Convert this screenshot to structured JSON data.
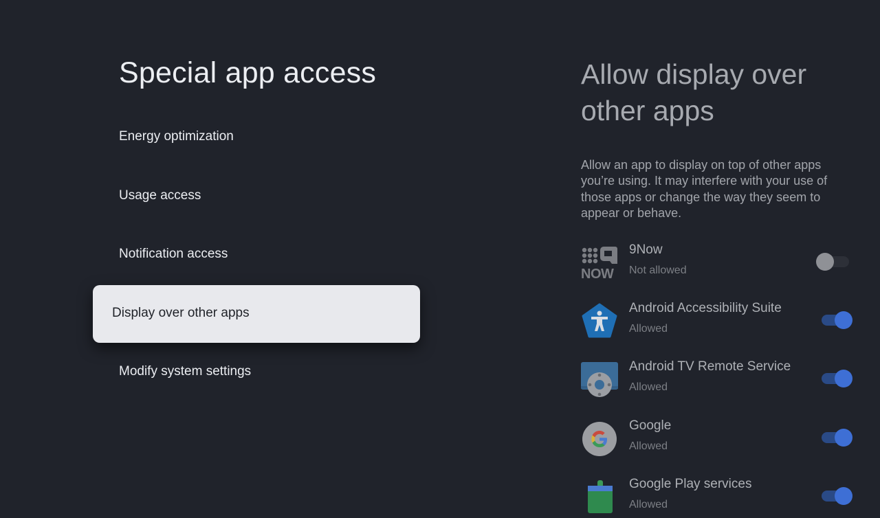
{
  "left_panel": {
    "title": "Special app access",
    "items": [
      {
        "label": "Energy optimization"
      },
      {
        "label": "Usage access"
      },
      {
        "label": "Notification access"
      },
      {
        "label": "Display over other apps",
        "focused": true
      },
      {
        "label": "Modify system settings"
      }
    ]
  },
  "right_panel": {
    "title": "Allow display over other apps",
    "description": "Allow an app to display on top of other apps you’re using. It may interfere with your use of those apps or change the way they seem to appear or behave.",
    "apps": [
      {
        "name": "9Now",
        "status": "Not allowed",
        "enabled": false,
        "icon": "9now-logo-icon"
      },
      {
        "name": "Android Accessibility Suite",
        "status": "Allowed",
        "enabled": true,
        "icon": "accessibility-icon"
      },
      {
        "name": "Android TV Remote Service",
        "status": "Allowed",
        "enabled": true,
        "icon": "tv-remote-icon"
      },
      {
        "name": "Google",
        "status": "Allowed",
        "enabled": true,
        "icon": "google-g-icon"
      },
      {
        "name": "Google Play services",
        "status": "Allowed",
        "enabled": true,
        "icon": "play-services-icon"
      }
    ],
    "icon_logo_text": {
      "nine_now_word": "NOW"
    }
  },
  "colors": {
    "background": "#20232b",
    "focused_item_bg": "#e8e9ed",
    "toggle_on": "#3e6fd5",
    "toggle_off": "#8f9196"
  }
}
